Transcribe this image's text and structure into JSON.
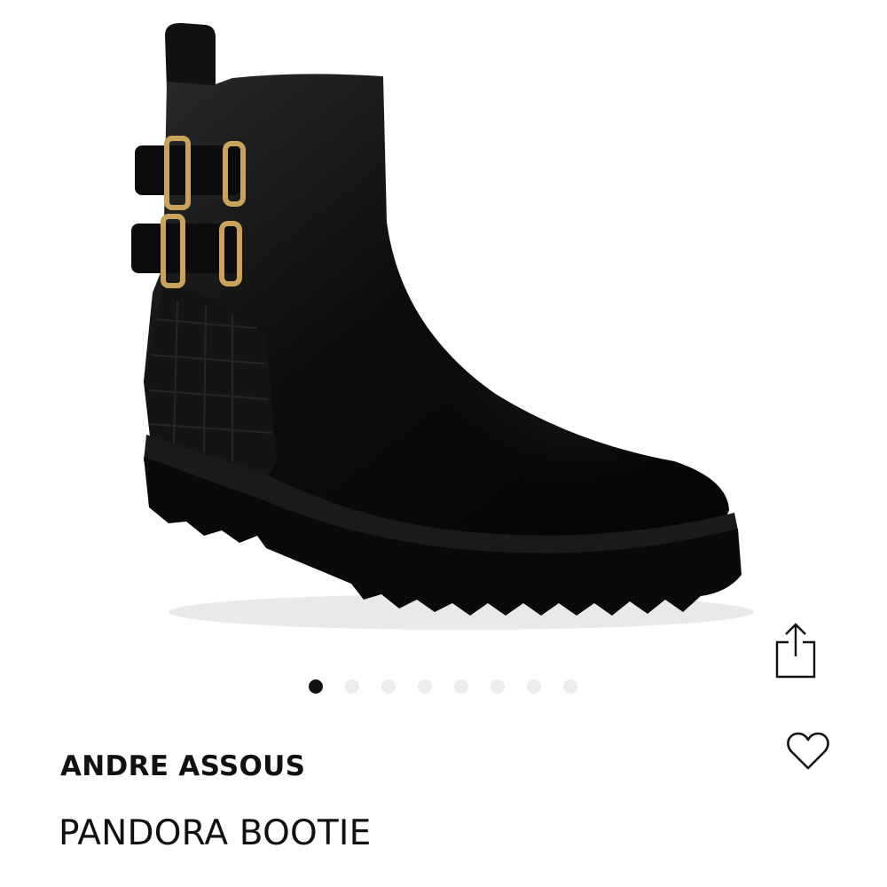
{
  "product": {
    "brand": "ANDRE ASSOUS",
    "name": "PANDORA BOOTIE"
  },
  "gallery": {
    "total_images": 8,
    "active_index": 0
  },
  "icons": {
    "share": "share-icon",
    "favorite": "heart-outline-icon"
  },
  "colors": {
    "text": "#111111",
    "dot_active": "#111111",
    "dot_inactive": "#ececec",
    "background": "#ffffff"
  }
}
